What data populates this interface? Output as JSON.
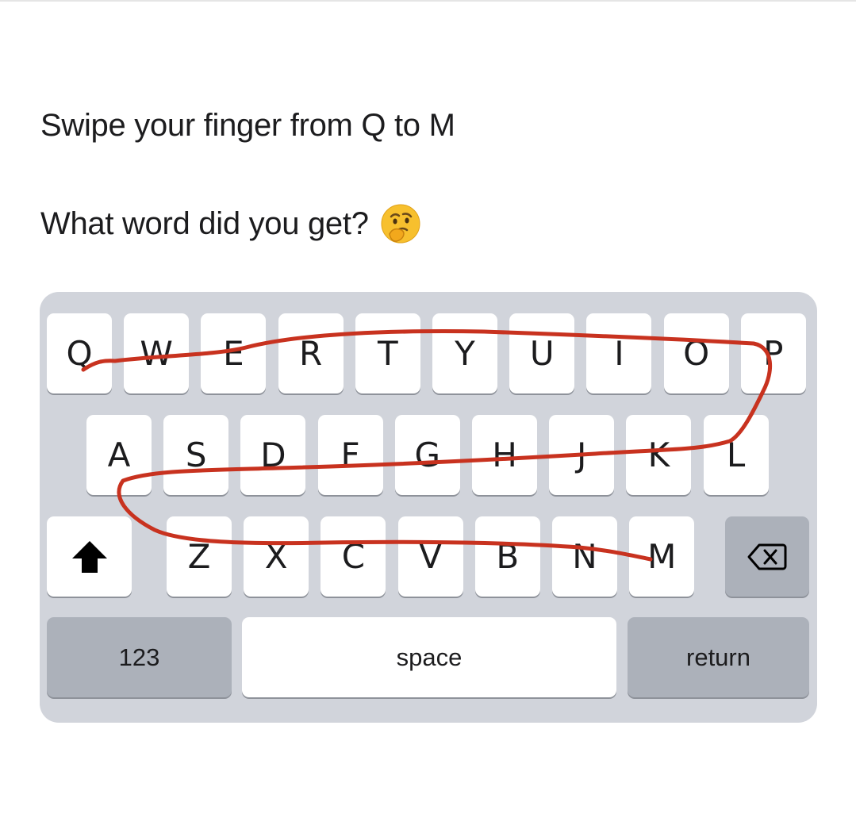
{
  "caption": {
    "line1": "Swipe your finger from Q to M",
    "line2": "What word did you get?",
    "emoji": "thinking-face-icon"
  },
  "keyboard": {
    "row1": [
      "Q",
      "W",
      "E",
      "R",
      "T",
      "Y",
      "U",
      "I",
      "O",
      "P"
    ],
    "row2": [
      "A",
      "S",
      "D",
      "F",
      "G",
      "H",
      "J",
      "K",
      "L"
    ],
    "row3": [
      "Z",
      "X",
      "C",
      "V",
      "B",
      "N",
      "M"
    ],
    "shift_icon": "shift-arrow-icon",
    "delete_icon": "delete-backspace-icon",
    "numbers_label": "123",
    "space_label": "space",
    "return_label": "return"
  },
  "colors": {
    "keyboard_bg": "#d1d4db",
    "key_bg": "#ffffff",
    "special_key_bg": "#acb1ba",
    "swipe_path": "#c8321f"
  }
}
